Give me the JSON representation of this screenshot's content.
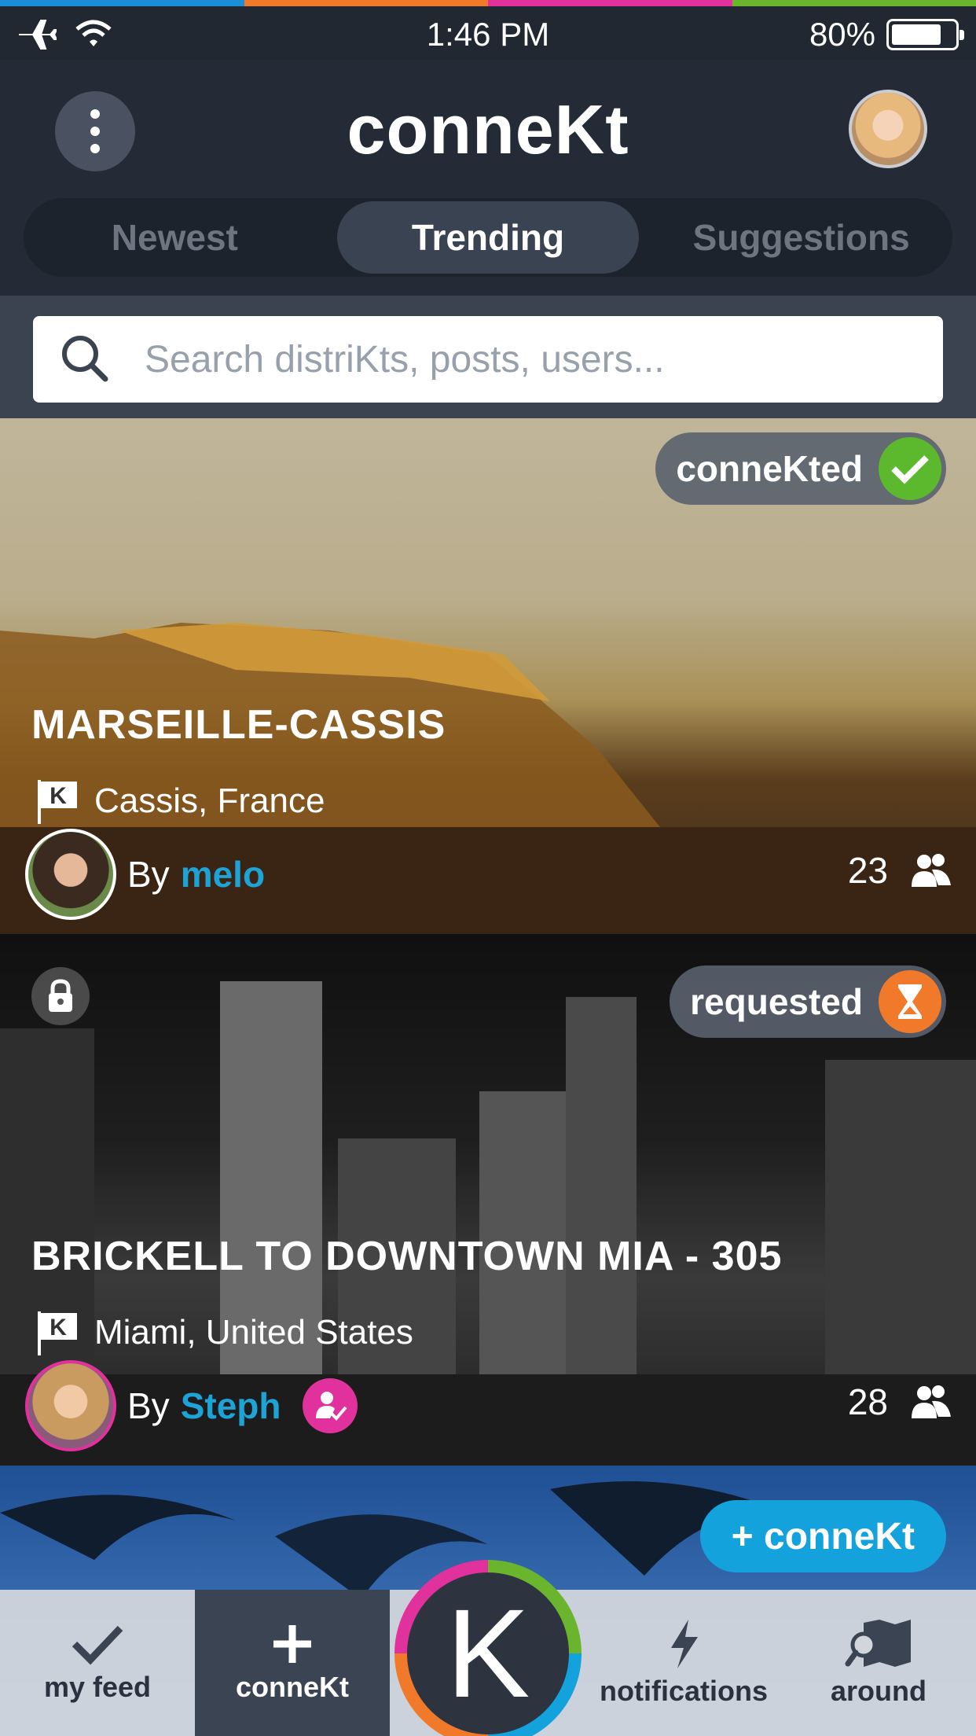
{
  "colors": {
    "stripe": [
      "#1a8fd8",
      "#f07a2a",
      "#e0319c",
      "#6bb52e"
    ],
    "accent_blue": "#13a2dc",
    "connected_green": "#5cb82d",
    "requested_orange": "#f07a2a",
    "verified_pink": "#e0319c"
  },
  "status_bar": {
    "time": "1:46 PM",
    "battery": "80%",
    "battery_level": 0.8,
    "icons": [
      "airplane-icon",
      "wifi-icon",
      "battery-icon"
    ]
  },
  "header": {
    "title": "conneKt",
    "menu_icon": "more-vertical-icon"
  },
  "tabs": [
    {
      "label": "Newest",
      "active": false
    },
    {
      "label": "Trending",
      "active": true
    },
    {
      "label": "Suggestions",
      "active": false
    }
  ],
  "search": {
    "placeholder": "Search distriKts, posts, users..."
  },
  "cards": [
    {
      "badge": "conneKted",
      "badge_icon": "check-icon",
      "title": "MARSEILLE-CASSIS",
      "location": "Cassis, France",
      "by": "By",
      "user": "melo",
      "count": "23",
      "locked": false
    },
    {
      "badge": "requested",
      "badge_icon": "hourglass-icon",
      "title": "BRICKELL TO DOWNTOWN MIA - 305",
      "location": "Miami, United States",
      "by": "By",
      "user": "Steph",
      "count": "28",
      "locked": true
    },
    {
      "badge": "+ conneKt",
      "badge_icon": "plus-icon"
    }
  ],
  "tabbar": [
    {
      "label": "my feed",
      "icon": "checkmark-icon",
      "active": false
    },
    {
      "label": "conneKt",
      "icon": "plus-icon",
      "active": true
    },
    {
      "label": "K",
      "icon": "k-logo-icon",
      "active": false
    },
    {
      "label": "notifications",
      "icon": "lightning-icon",
      "active": false
    },
    {
      "label": "around",
      "icon": "map-search-icon",
      "active": false
    }
  ]
}
